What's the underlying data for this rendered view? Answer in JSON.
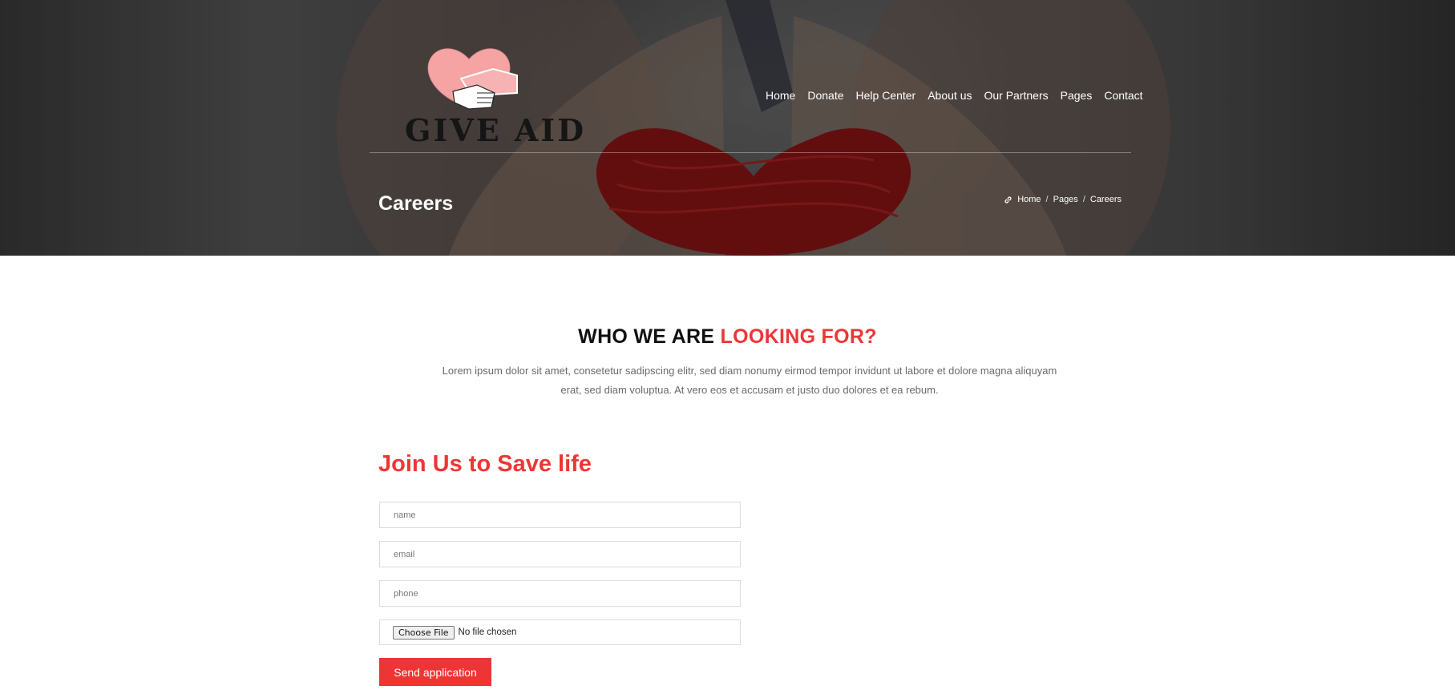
{
  "brand": {
    "name": "GIVE AID",
    "colors": {
      "accent": "#ee3535",
      "logo_heart": "#f5a3a3"
    }
  },
  "nav": {
    "items": [
      "Home",
      "Donate",
      "Help Center",
      "About us",
      "Our Partners",
      "Pages",
      "Contact"
    ]
  },
  "hero": {
    "page_title": "Careers",
    "breadcrumb": {
      "icon": "link-icon",
      "items": [
        "Home",
        "Pages",
        "Careers"
      ],
      "separator": "/"
    }
  },
  "who": {
    "heading_main": "WHO WE ARE",
    "heading_accent": "LOOKING FOR?",
    "description": "Lorem ipsum dolor sit amet, consetetur sadipscing elitr, sed diam nonumy eirmod tempor invidunt ut labore et dolore magna aliquyam erat, sed diam voluptua. At vero eos et accusam et justo duo dolores et ea rebum."
  },
  "form": {
    "title": "Join Us to Save life",
    "name_placeholder": "name",
    "email_placeholder": "email",
    "phone_placeholder": "phone",
    "file_button": "Choose File",
    "file_status": "No file chosen",
    "submit_label": "Send application"
  }
}
